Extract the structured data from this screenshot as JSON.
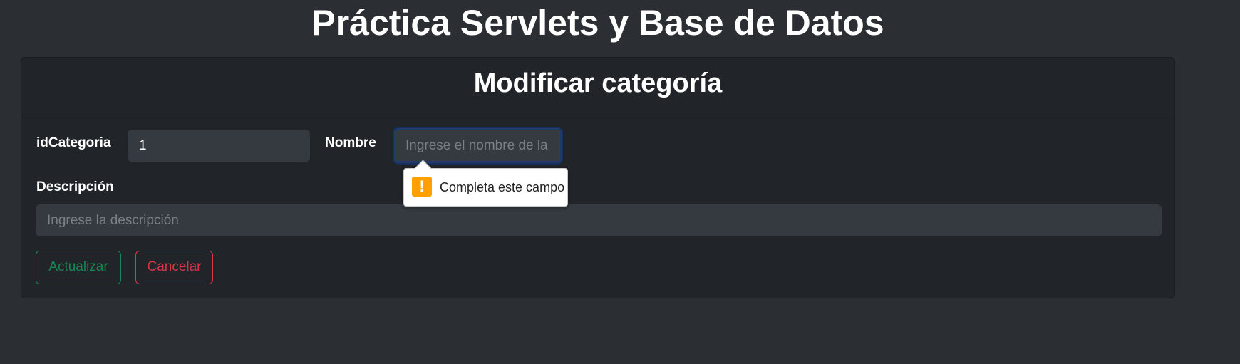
{
  "page": {
    "title": "Práctica Servlets y Base de Datos"
  },
  "card": {
    "title": "Modificar categoría"
  },
  "form": {
    "id_label": "idCategoria",
    "id_value": "1",
    "nombre_label": "Nombre",
    "nombre_placeholder": "Ingrese el nombre de la categoría",
    "descripcion_label": "Descripción",
    "descripcion_placeholder": "Ingrese la descripción"
  },
  "buttons": {
    "update_label": "Actualizar",
    "cancel_label": "Cancelar"
  },
  "validation": {
    "message": "Completa este campo",
    "icon": "warning-icon",
    "icon_glyph": "!"
  },
  "colors": {
    "background": "#2b2e33",
    "card": "#212529",
    "input": "#353a40",
    "success": "#198754",
    "danger": "#dc3545",
    "warning": "#ffa000"
  }
}
